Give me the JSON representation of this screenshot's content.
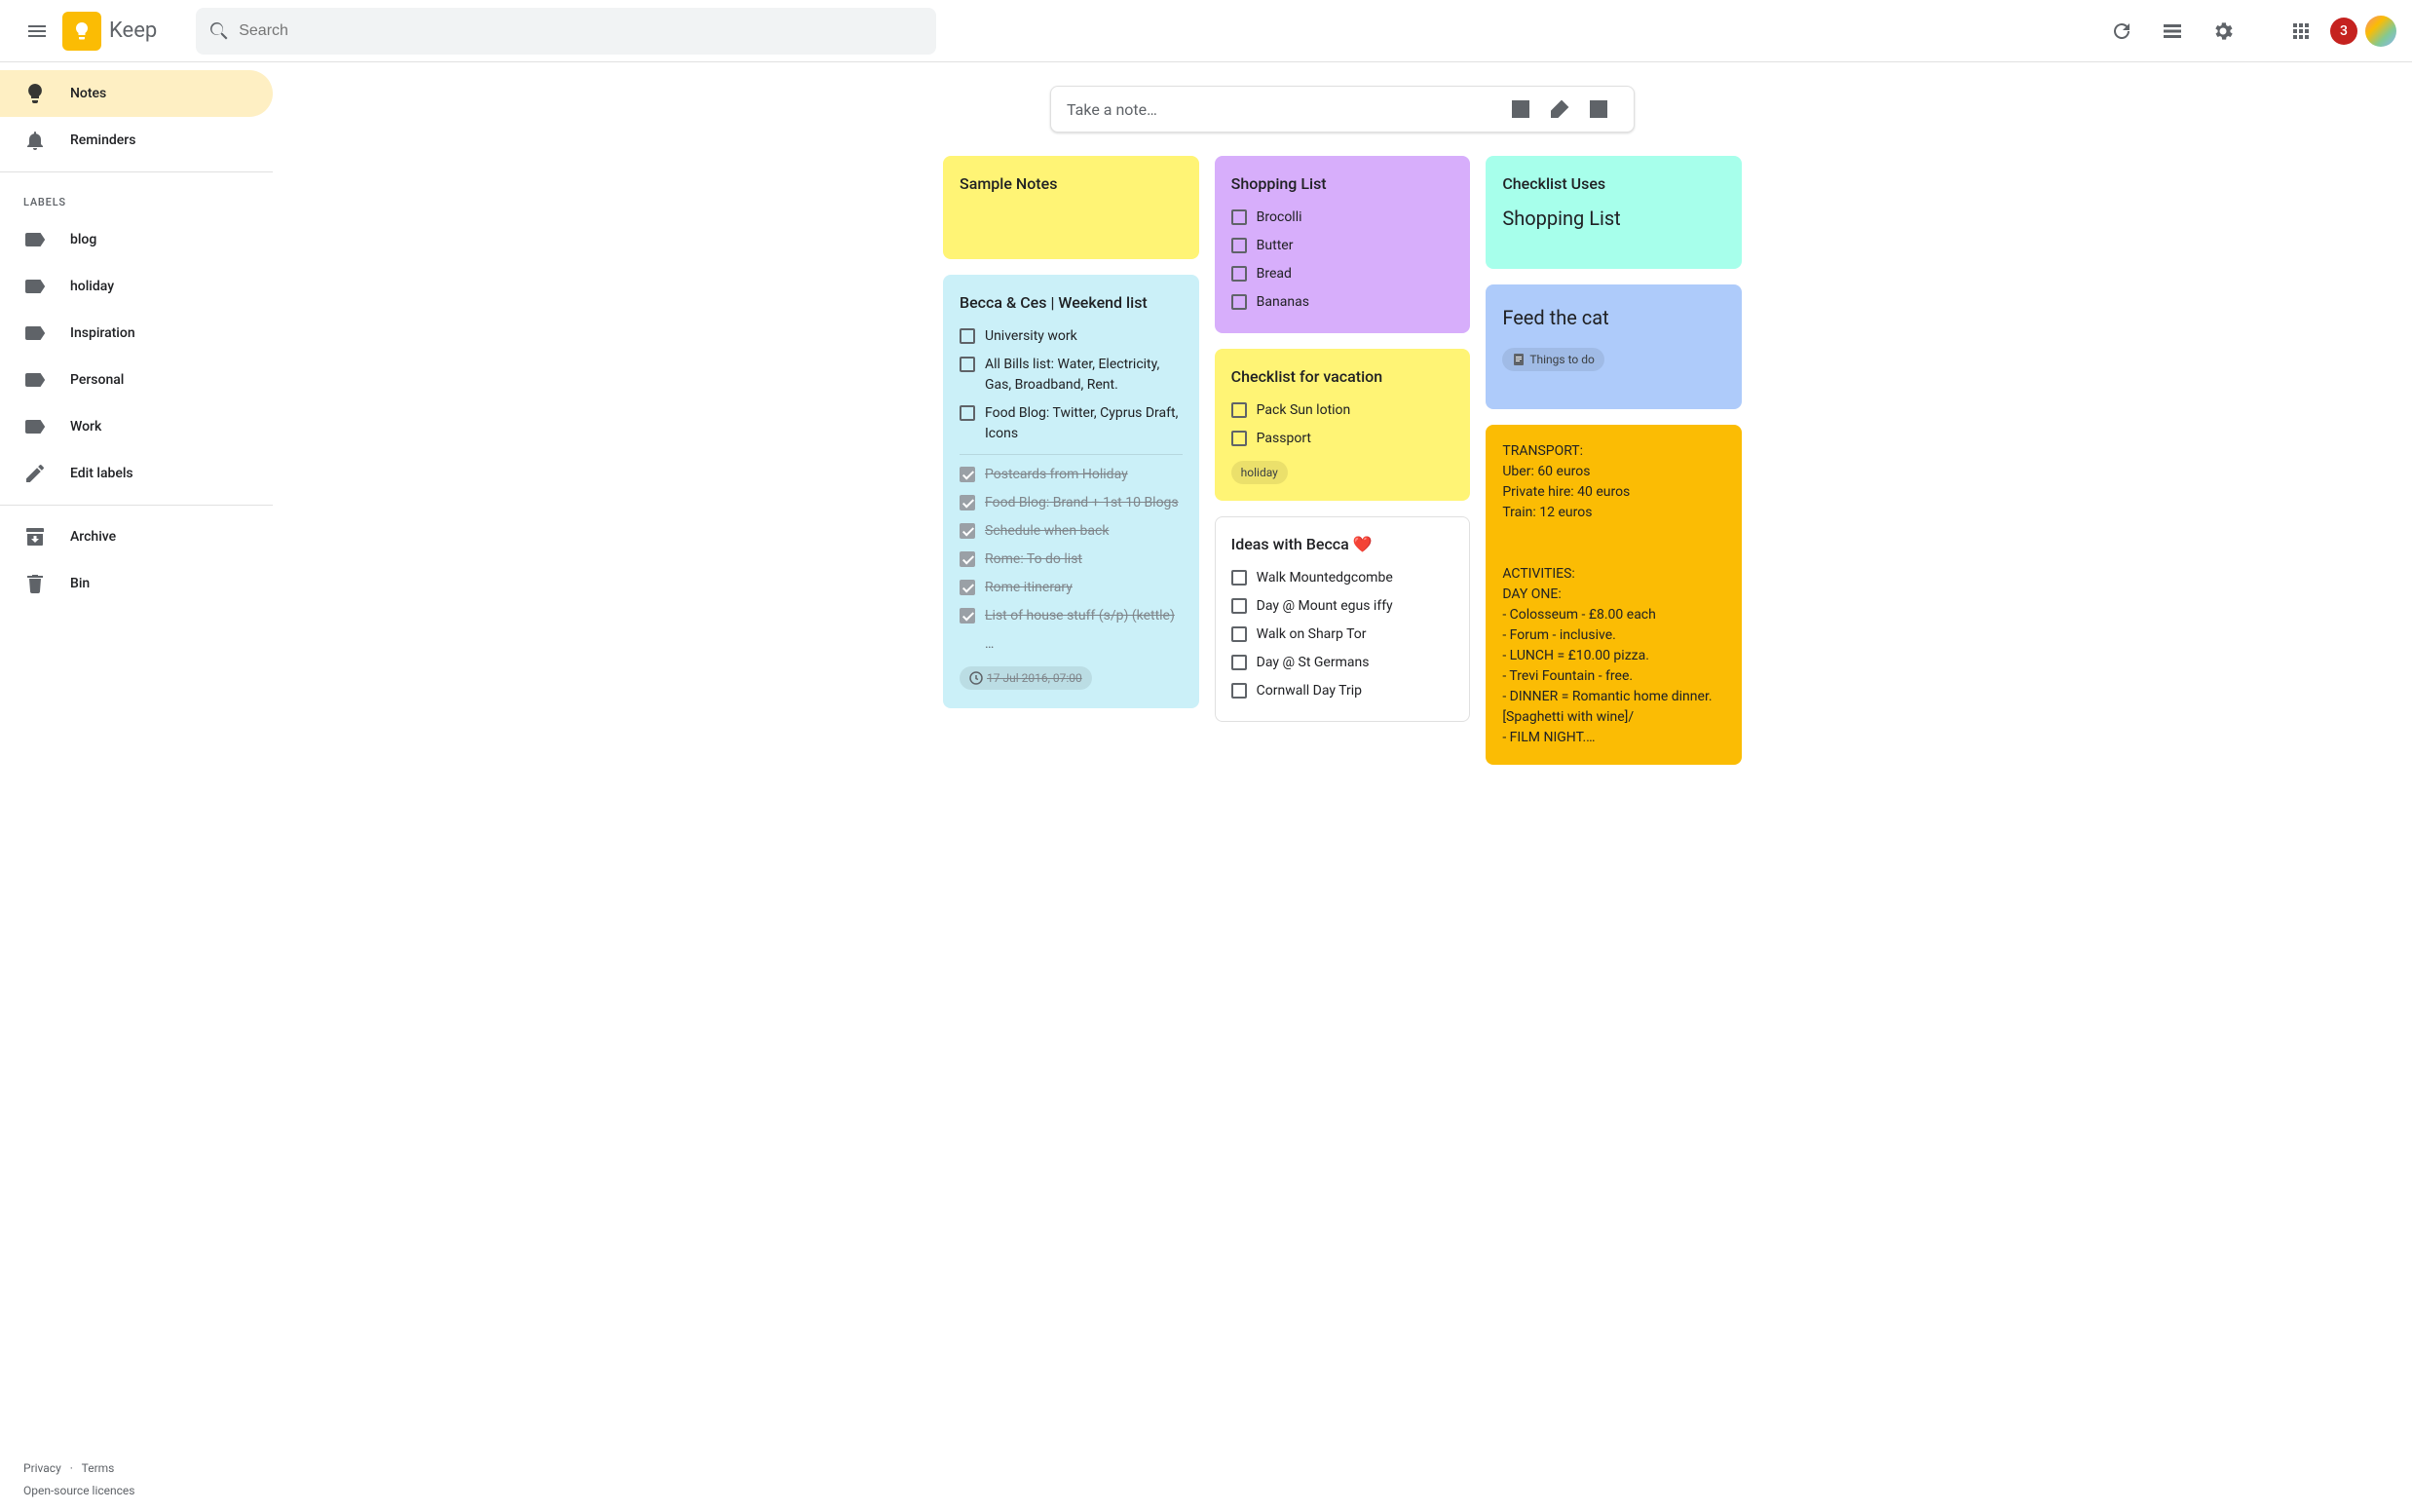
{
  "header": {
    "app_name": "Keep",
    "search_placeholder": "Search",
    "badge_count": "3"
  },
  "sidebar": {
    "notes": "Notes",
    "reminders": "Reminders",
    "labels_header": "LABELS",
    "labels": [
      "blog",
      "holiday",
      "Inspiration",
      "Personal",
      "Work"
    ],
    "edit_labels": "Edit labels",
    "archive": "Archive",
    "bin": "Bin"
  },
  "footer": {
    "privacy": "Privacy",
    "sep": "·",
    "terms": "Terms",
    "licences": "Open-source licences"
  },
  "take_note": {
    "placeholder": "Take a note…"
  },
  "notes": {
    "col1": {
      "sample": {
        "title": "Sample Notes"
      },
      "weekend": {
        "title": "Becca & Ces | Weekend list",
        "items": [
          "University work",
          "All Bills list: Water, Electricity, Gas, Broadband, Rent.",
          "Food Blog: Twitter, Cyprus Draft, Icons"
        ],
        "done": [
          "Postcards from Holiday",
          "Food Blog: Brand + 1st 10 Blogs",
          "Schedule when back",
          "Rome: To do list",
          "Rome itinerary",
          "List of house stuff (s/p) (kettle)"
        ],
        "overflow": "…",
        "reminder": "17 Jul 2016, 07:00"
      }
    },
    "col2": {
      "shopping": {
        "title": "Shopping List",
        "items": [
          "Brocolli",
          "Butter",
          "Bread",
          "Bananas"
        ]
      },
      "vacation": {
        "title": "Checklist for vacation",
        "items": [
          "Pack Sun lotion",
          "Passport"
        ],
        "label": "holiday"
      },
      "ideas": {
        "title": "Ideas with Becca ❤️",
        "items": [
          "Walk Mountedgcombe",
          "Day @ Mount egus iffy",
          "Walk on Sharp Tor",
          "Day @ St Germans",
          "Cornwall Day Trip"
        ]
      }
    },
    "col3": {
      "uses": {
        "title": "Checklist Uses",
        "subtitle": "Shopping List"
      },
      "feedcat": {
        "title": "Feed the cat",
        "chip": "Things to do"
      },
      "transport": {
        "body": "TRANSPORT:\nUber: 60 euros\nPrivate hire: 40 euros\nTrain: 12 euros\n\n\nACTIVITIES:\nDAY ONE:\n- Colosseum - £8.00 each\n- Forum - inclusive.\n- LUNCH = £10.00 pizza.\n- Trevi Fountain - free.\n- DINNER = Romantic home dinner. [Spaghetti with wine]/\n- FILM NIGHT.…"
      }
    }
  }
}
